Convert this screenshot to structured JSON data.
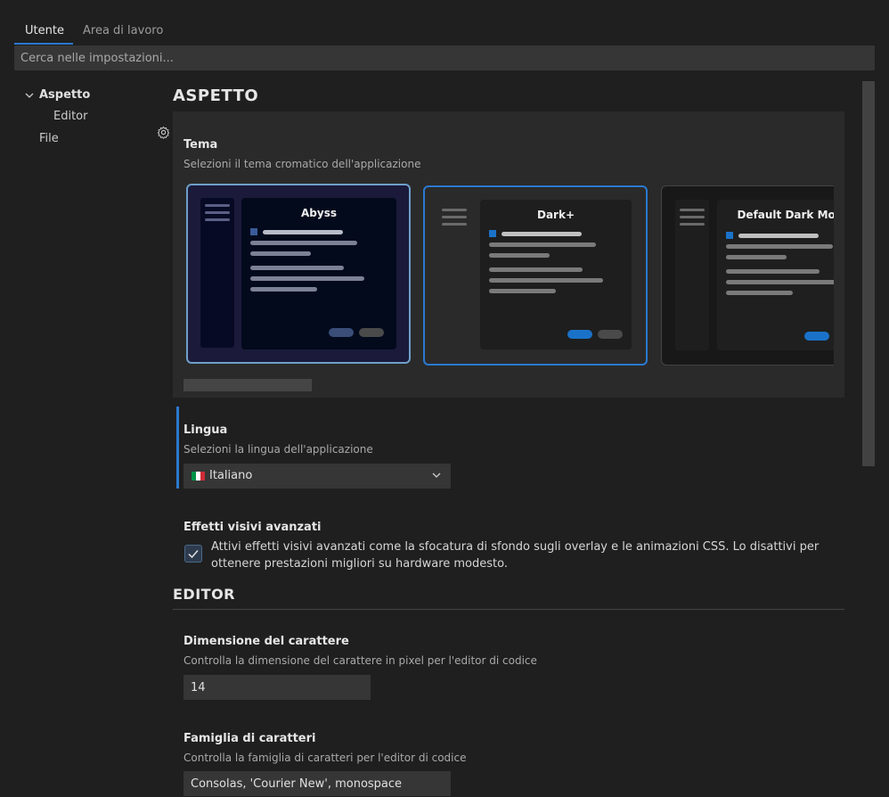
{
  "tabs": [
    {
      "label": "Utente",
      "active": true
    },
    {
      "label": "Area di lavoro",
      "active": false
    }
  ],
  "search": {
    "placeholder": "Cerca nelle impostazioni..."
  },
  "tree": [
    {
      "label": "Aspetto",
      "expanded": true
    },
    {
      "label": "Editor"
    },
    {
      "label": "File"
    }
  ],
  "sections": {
    "aspetto": "ASPETTO",
    "editor": "EDITOR"
  },
  "theme": {
    "title": "Tema",
    "description": "Selezioni il tema cromatico dell'applicazione",
    "options": [
      {
        "name": "Abyss",
        "selected": false
      },
      {
        "name": "Dark+",
        "selected": true
      },
      {
        "name": "Default Dark Mode",
        "selected": false
      }
    ]
  },
  "language": {
    "title": "Lingua",
    "description": "Selezioni la lingua dell'applicazione",
    "value": "Italiano",
    "flag_colors": [
      "#009246",
      "#ffffff",
      "#ce2b37"
    ]
  },
  "visual_effects": {
    "title": "Effetti visivi avanzati",
    "description": "Attivi effetti visivi avanzati come la sfocatura di sfondo sugli overlay e le animazioni CSS. Lo disattivi per ottenere prestazioni migliori su hardware modesto.",
    "checked": true
  },
  "font_size": {
    "title": "Dimensione del carattere",
    "description": "Controlla la dimensione del carattere in pixel per l'editor di codice",
    "value": "14"
  },
  "font_family": {
    "title": "Famiglia di caratteri",
    "description": "Controlla la famiglia di caratteri per l'editor di codice",
    "value": "Consolas, 'Courier New', monospace"
  },
  "colors": {
    "accent": "#2b79d0",
    "background": "#1f1f1f",
    "input": "#363636"
  }
}
